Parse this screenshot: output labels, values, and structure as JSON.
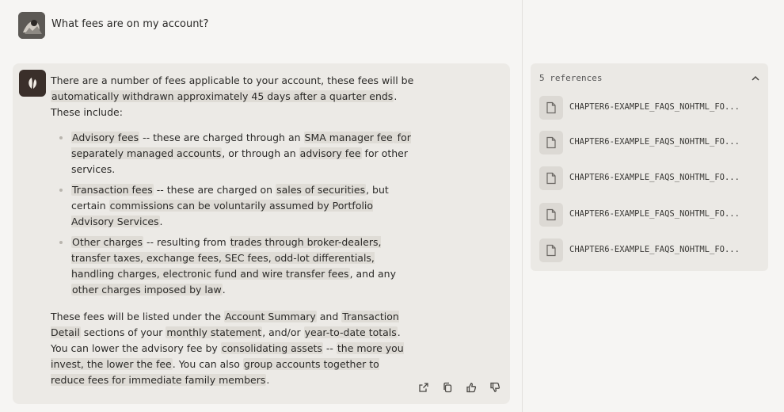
{
  "user_message": "What fees are on my account?",
  "answer": {
    "intro": [
      {
        "t": "There are a number of fees applicable to your account, these fees will be ",
        "h": false
      },
      {
        "t": "automatically withdrawn approximately 45 days after a quarter ends",
        "h": true
      },
      {
        "t": ". These include:",
        "h": false
      }
    ],
    "bullets": [
      [
        {
          "t": "Advisory fees",
          "h": true
        },
        {
          "t": " -- these are charged through an ",
          "h": false
        },
        {
          "t": "SMA manager fee",
          "h": true
        },
        {
          "t": " for separately managed accounts",
          "h": true
        },
        {
          "t": ", or through an ",
          "h": false
        },
        {
          "t": "advisory fee",
          "h": true
        },
        {
          "t": " for other services.",
          "h": false
        }
      ],
      [
        {
          "t": "Transaction fees",
          "h": true
        },
        {
          "t": " -- these are charged on ",
          "h": false
        },
        {
          "t": "sales of securities",
          "h": true
        },
        {
          "t": ", but certain ",
          "h": false
        },
        {
          "t": "commissions can be voluntarily assumed by Portfolio Advisory Services",
          "h": true
        },
        {
          "t": ".",
          "h": false
        }
      ],
      [
        {
          "t": "Other charges",
          "h": true
        },
        {
          "t": " -- resulting from ",
          "h": false
        },
        {
          "t": "trades through broker-dealers, transfer taxes, exchange fees, SEC fees, odd-lot differentials, handling charges, electronic fund and wire transfer fees",
          "h": true
        },
        {
          "t": ", and any ",
          "h": false
        },
        {
          "t": "other charges imposed by law",
          "h": true
        },
        {
          "t": ".",
          "h": false
        }
      ]
    ],
    "closing": [
      {
        "t": "These fees will be listed under the ",
        "h": false
      },
      {
        "t": "Account Summary",
        "h": true
      },
      {
        "t": " and ",
        "h": false
      },
      {
        "t": "Transaction Detail",
        "h": true
      },
      {
        "t": " sections of your ",
        "h": false
      },
      {
        "t": "monthly statement",
        "h": true
      },
      {
        "t": ", and/or ",
        "h": false
      },
      {
        "t": "year-to-date totals",
        "h": true
      },
      {
        "t": ". You can lower the advisory fee by ",
        "h": false
      },
      {
        "t": "consolidating assets",
        "h": true
      },
      {
        "t": " -- ",
        "h": false
      },
      {
        "t": "the more you invest, the lower the fee",
        "h": true
      },
      {
        "t": ". You can also ",
        "h": false
      },
      {
        "t": "group accounts together to reduce fees for immediate family members",
        "h": true
      },
      {
        "t": ".",
        "h": false
      }
    ]
  },
  "actions": [
    "share-icon",
    "copy-icon",
    "thumbs-up-icon",
    "thumbs-down-icon"
  ],
  "references": {
    "header": "5 references",
    "items": [
      "CHAPTER6-EXAMPLE_FAQS_NOHTML_FO...",
      "CHAPTER6-EXAMPLE_FAQS_NOHTML_FO...",
      "CHAPTER6-EXAMPLE_FAQS_NOHTML_FO...",
      "CHAPTER6-EXAMPLE_FAQS_NOHTML_FO...",
      "CHAPTER6-EXAMPLE_FAQS_NOHTML_FO..."
    ]
  },
  "colors": {
    "background": "#f6f5f3",
    "card": "#eceae6",
    "highlight": "#dfdcd6",
    "bot_avatar": "#3a2f2a"
  }
}
